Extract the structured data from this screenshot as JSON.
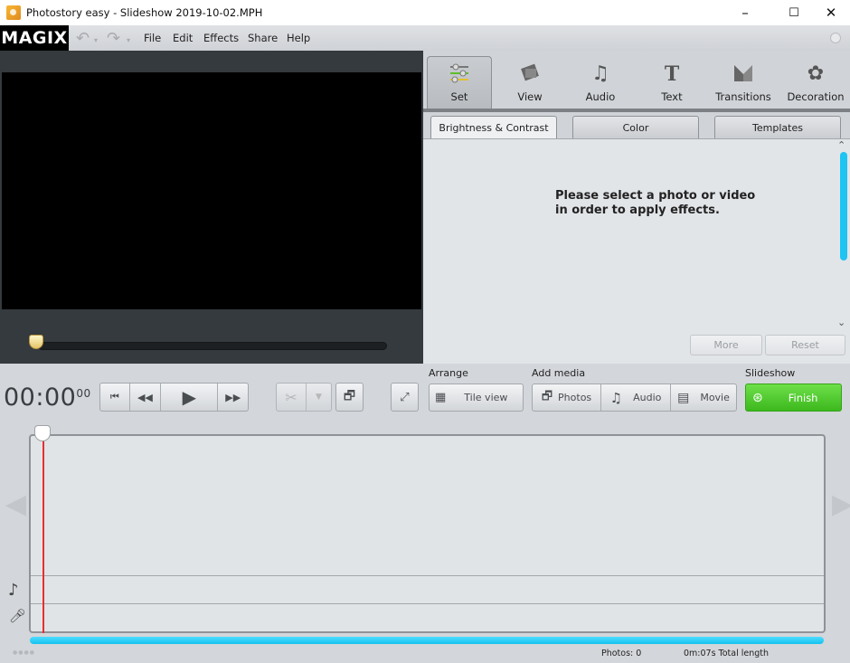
{
  "window": {
    "title": "Photostory easy - Slideshow 2019-10-02.MPH",
    "controls": {
      "minimize": "–",
      "maximize": "☐",
      "close": "✕"
    }
  },
  "menubar": {
    "logo": "MAGIX",
    "undo_icon": "↶",
    "redo_icon": "↷",
    "items": [
      "File",
      "Edit",
      "Effects",
      "Share",
      "Help"
    ]
  },
  "preview": {
    "scrub_position": 0
  },
  "effects_panel": {
    "main_tabs": [
      {
        "label": "Set",
        "icon": "sliders-icon",
        "glyph": "☰",
        "active": true
      },
      {
        "label": "View",
        "icon": "view-icon",
        "glyph": "◩",
        "active": false
      },
      {
        "label": "Audio",
        "icon": "music-note-icon",
        "glyph": "♫",
        "active": false
      },
      {
        "label": "Text",
        "icon": "text-icon",
        "glyph": "T",
        "active": false
      },
      {
        "label": "Transitions",
        "icon": "transitions-icon",
        "glyph": "◣",
        "active": false
      },
      {
        "label": "Decoration",
        "icon": "decoration-icon",
        "glyph": "✿",
        "active": false
      }
    ],
    "sub_tabs": [
      {
        "label": "Brightness & Contrast",
        "active": true
      },
      {
        "label": "Color",
        "active": false
      },
      {
        "label": "Templates",
        "active": false
      }
    ],
    "message_line1": "Please select a photo or video",
    "message_line2": "in order to apply effects.",
    "more_label": "More",
    "reset_label": "Reset"
  },
  "transport": {
    "timecode": "00:00",
    "timecode_frames": "00",
    "buttons": [
      "go-to-start",
      "rewind",
      "play",
      "fast-forward"
    ]
  },
  "toolbar": {
    "arrange_label": "Arrange",
    "tile_view_label": "Tile view",
    "add_media_label": "Add media",
    "photos_label": "Photos",
    "audio_label": "Audio",
    "movie_label": "Movie",
    "slideshow_label": "Slideshow",
    "finish_label": "Finish",
    "colors": {
      "finish": "#4cc82a",
      "progress": "#1ec4f2",
      "playhead": "#e53030"
    }
  },
  "statusbar": {
    "photos": "Photos: 0",
    "total_length": "0m:07s Total length",
    "dots": "●●●●"
  }
}
